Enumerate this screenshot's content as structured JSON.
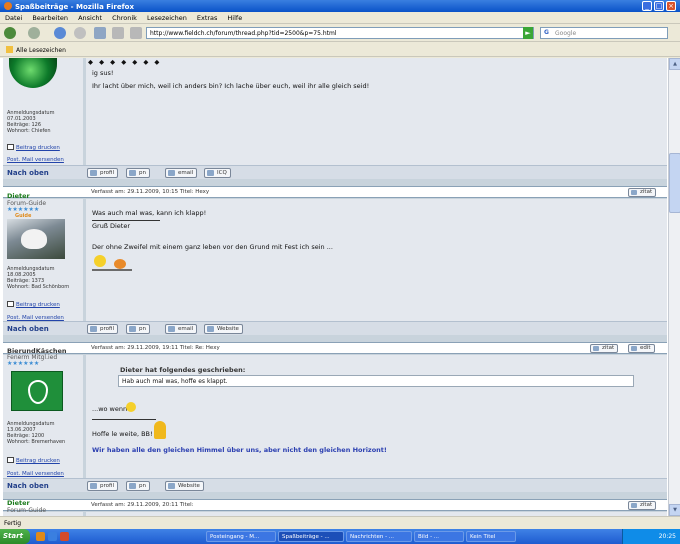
{
  "window": {
    "title": "Spaßbeiträge - Mozilla Firefox",
    "controls": [
      "_",
      "□",
      "×"
    ]
  },
  "menu": [
    "Datei",
    "Bearbeiten",
    "Ansicht",
    "Chronik",
    "Lesezeichen",
    "Extras",
    "Hilfe"
  ],
  "toolbar": {
    "url": "http://www.fieldch.ch/forum/thread.php?tid=2500&p=75.html",
    "search_placeholder": "Google"
  },
  "bookmarks": {
    "label": "Alle Lesezeichen"
  },
  "posts": [
    {
      "meta": [
        "Anmeldungsdatum",
        "07.01.2003",
        "Beiträge: 126",
        "Wohnort: Chiefen"
      ],
      "links": [
        "Beitrag drucken",
        "Post. Mail versenden"
      ],
      "text": [
        "ig sus!",
        "Ihr lacht über mich, weil ich anders bin? Ich lache über euch, weil ihr alle gleich seid!"
      ],
      "nach_oben": "Nach oben",
      "buttons": [
        "profil",
        "pn",
        "email",
        "ICQ"
      ]
    },
    {
      "user": "Dieter",
      "rank": "Forum-Guide",
      "stars": "★★★★★★",
      "guide": "Guide",
      "header": "Verfasst am: 29.11.2009, 10:15    Titel: Hexy",
      "meta": [
        "Anmeldungsdatum",
        "18.08.2005",
        "Beiträge: 1373",
        "Wohnort: Bad Schönborn"
      ],
      "links": [
        "Beitrag drucken",
        "Post. Mail versenden"
      ],
      "text": [
        "Was auch mal was, kann ich klapp!",
        "Gruß Dieter",
        "Der ohne Zweifel mit einem ganz leben vor den Grund mit Fest ich sein ..."
      ],
      "header_button": "zitat",
      "nach_oben": "Nach oben",
      "buttons": [
        "profil",
        "pn",
        "email",
        "Website"
      ]
    },
    {
      "user": "BierundKäschen",
      "rank": "Fenerm Mitgl.ied",
      "stars": "★★★★★★",
      "header": "Verfasst am: 29.11.2009, 19:11    Titel: Re: Hexy",
      "meta": [
        "Anmeldungsdatum",
        "13.06.2007",
        "Beiträge: 1200",
        "Wohnort: Bremerhaven"
      ],
      "links": [
        "Beitrag drucken",
        "Post. Mail versenden"
      ],
      "quote_by": "Dieter hat folgendes geschrieben:",
      "quote": "Hab auch mal was, hoffe es klappt.",
      "text": [
        "...wo wenn",
        "Hoffe le weite, BB!"
      ],
      "signature": "Wir haben alle den gleichen Himmel über uns, aber nicht den gleichen Horizont!",
      "header_buttons": [
        "zitat",
        "edit"
      ],
      "nach_oben": "Nach oben",
      "buttons": [
        "profil",
        "pn",
        "Website"
      ]
    },
    {
      "user": "Dieter",
      "rank": "Forum-Guide",
      "header": "Verfasst am: 29.11.2009, 20:11    Titel:",
      "header_button": "zitat"
    }
  ],
  "status": "Fertig",
  "taskbar": {
    "start": "Start",
    "tasks": [
      "Posteingang - M...",
      "Spaßbeiträge - ...",
      "Nachrichten - ...",
      "Bild - ...",
      "Kein Titel"
    ],
    "clock": "20:25"
  },
  "colors": {
    "title_bar": "#0a52c8",
    "post_bg": "#e4e8ee",
    "link": "#2244aa",
    "signature": "#2a3eb0",
    "username": "#1a7a1a"
  }
}
